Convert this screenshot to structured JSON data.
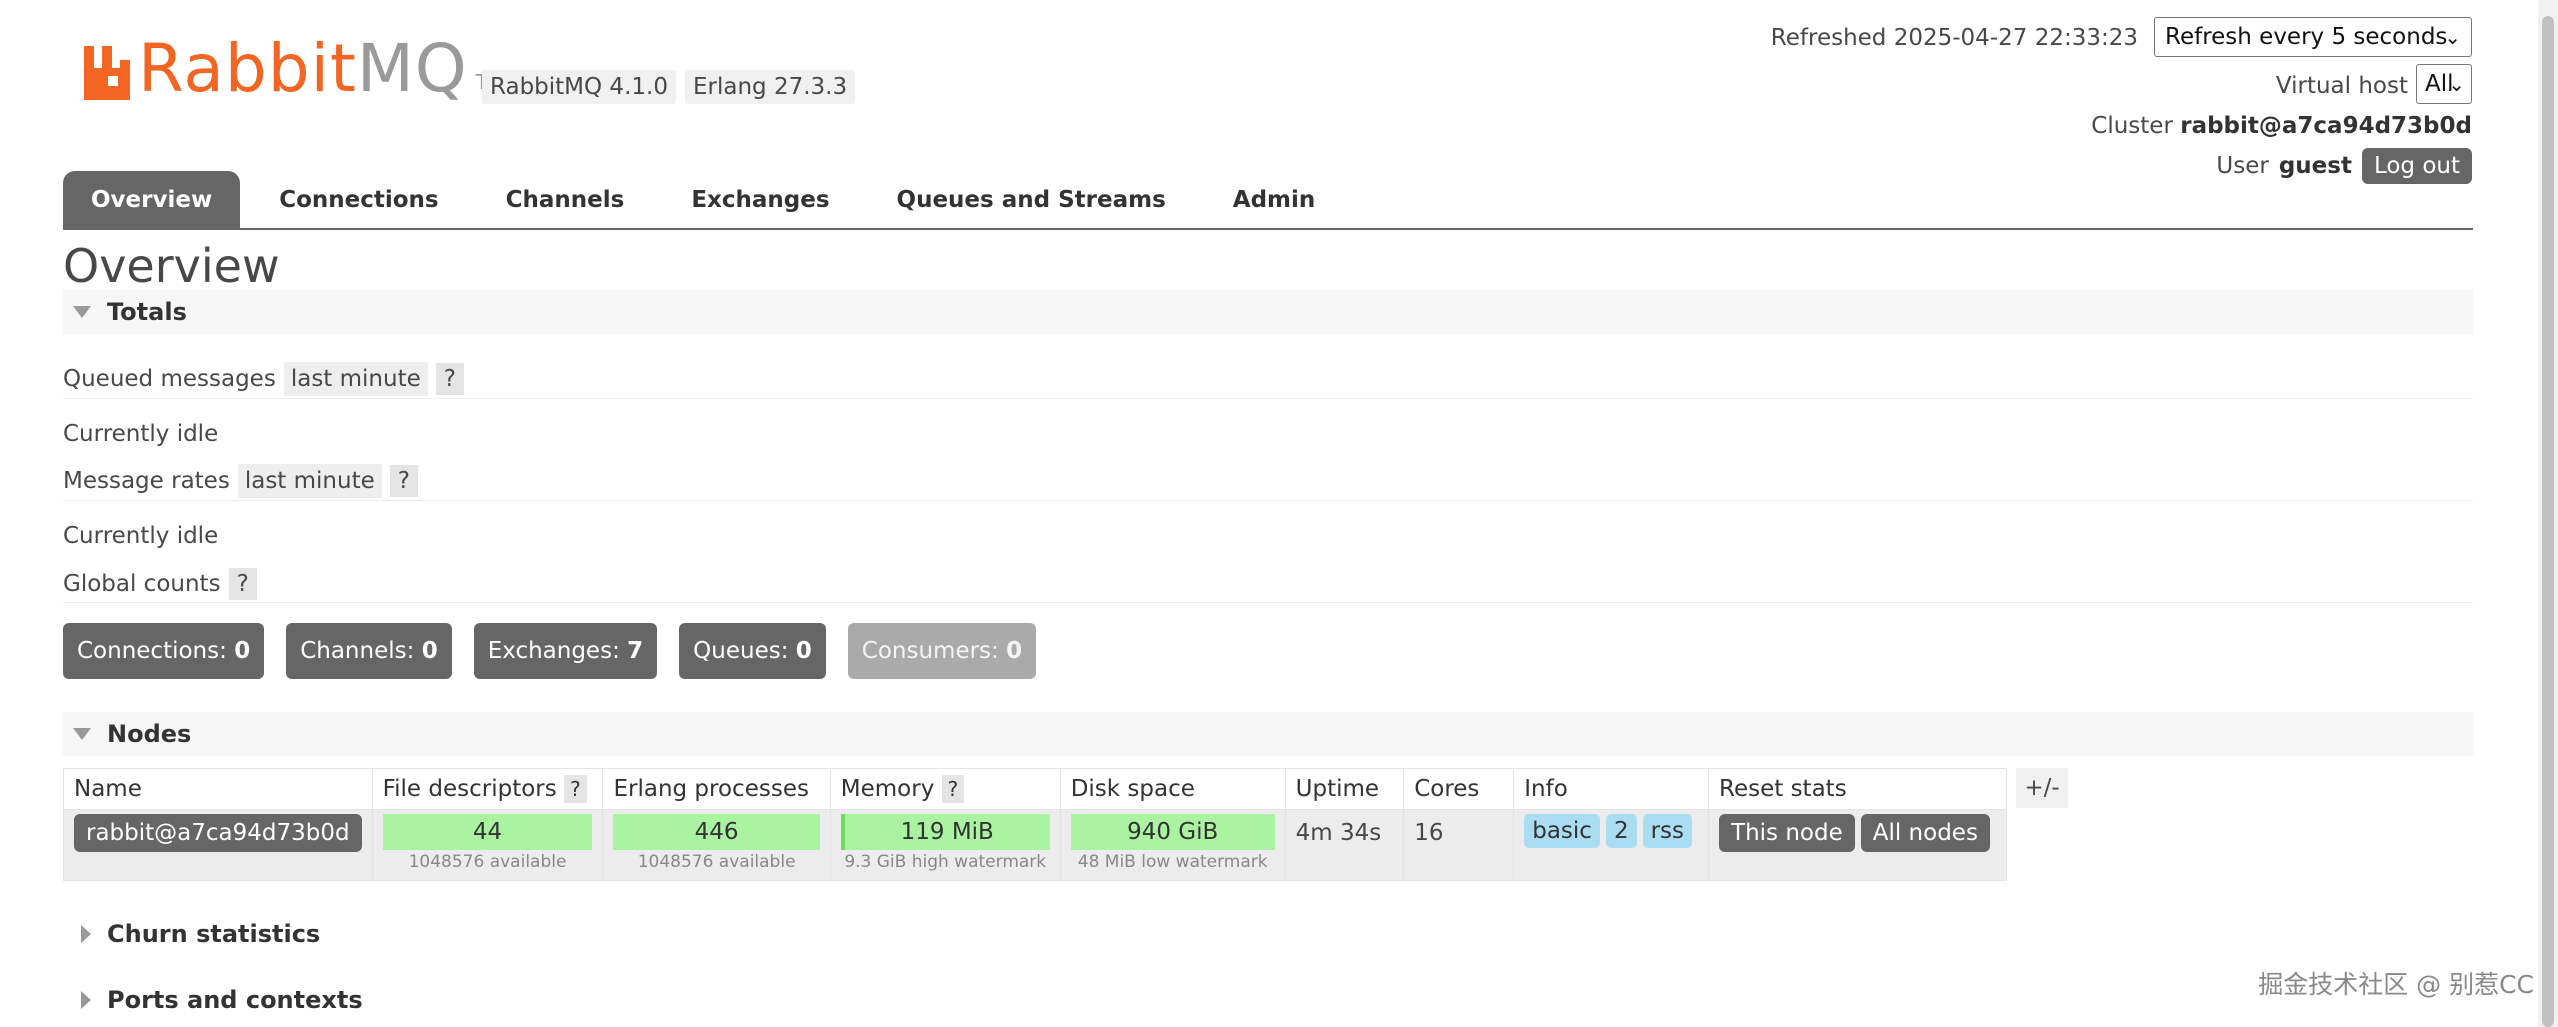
{
  "header": {
    "logo_text_primary": "Rabbit",
    "logo_text_secondary": "MQ",
    "logo_tm": "TM",
    "rabbitmq_version": "RabbitMQ 4.1.0",
    "erlang_version": "Erlang 27.3.3",
    "refreshed_text": "Refreshed 2025-04-27 22:33:23",
    "refresh_select_value": "Refresh every 5 seconds",
    "vhost_label": "Virtual host",
    "vhost_value": "All",
    "cluster_label": "Cluster",
    "cluster_name": "rabbit@a7ca94d73b0d",
    "user_label": "User",
    "user_name": "guest",
    "logout_label": "Log out"
  },
  "tabs": [
    {
      "label": "Overview",
      "active": true
    },
    {
      "label": "Connections"
    },
    {
      "label": "Channels"
    },
    {
      "label": "Exchanges"
    },
    {
      "label": "Queues and Streams"
    },
    {
      "label": "Admin"
    }
  ],
  "page_title": "Overview",
  "totals": {
    "heading": "Totals",
    "queued_messages_label": "Queued messages",
    "queued_range": "last minute",
    "help_mark": "?",
    "queued_idle": "Currently idle",
    "message_rates_label": "Message rates",
    "rates_range": "last minute",
    "rates_idle": "Currently idle",
    "global_counts_label": "Global counts",
    "counts": [
      {
        "label": "Connections:",
        "value": "0"
      },
      {
        "label": "Channels:",
        "value": "0"
      },
      {
        "label": "Exchanges:",
        "value": "7"
      },
      {
        "label": "Queues:",
        "value": "0"
      },
      {
        "label": "Consumers:",
        "value": "0"
      }
    ]
  },
  "nodes": {
    "heading": "Nodes",
    "columns": [
      "Name",
      "File descriptors",
      "Erlang processes",
      "Memory",
      "Disk space",
      "Uptime",
      "Cores",
      "Info",
      "Reset stats"
    ],
    "plus_minus": "+/-",
    "row": {
      "name": "rabbit@a7ca94d73b0d",
      "file_descriptors": "44",
      "file_descriptors_sub": "1048576 available",
      "erlang_processes": "446",
      "erlang_processes_sub": "1048576 available",
      "memory": "119 MiB",
      "memory_sub": "9.3 GiB high watermark",
      "disk_space": "940 GiB",
      "disk_space_sub": "48 MiB low watermark",
      "uptime": "4m 34s",
      "cores": "16",
      "info_tags": [
        "basic",
        "2",
        "rss"
      ],
      "reset_this_node": "This node",
      "reset_all_nodes": "All nodes"
    }
  },
  "collapsed_sections": [
    "Churn statistics",
    "Ports and contexts"
  ],
  "watermark": "掘金技术社区 @ 别惹CC",
  "colors": {
    "brand_orange": "#f26522",
    "dark_gray": "#666666",
    "green_bar": "#a9f3a1",
    "info_blue": "#aaddf2"
  }
}
